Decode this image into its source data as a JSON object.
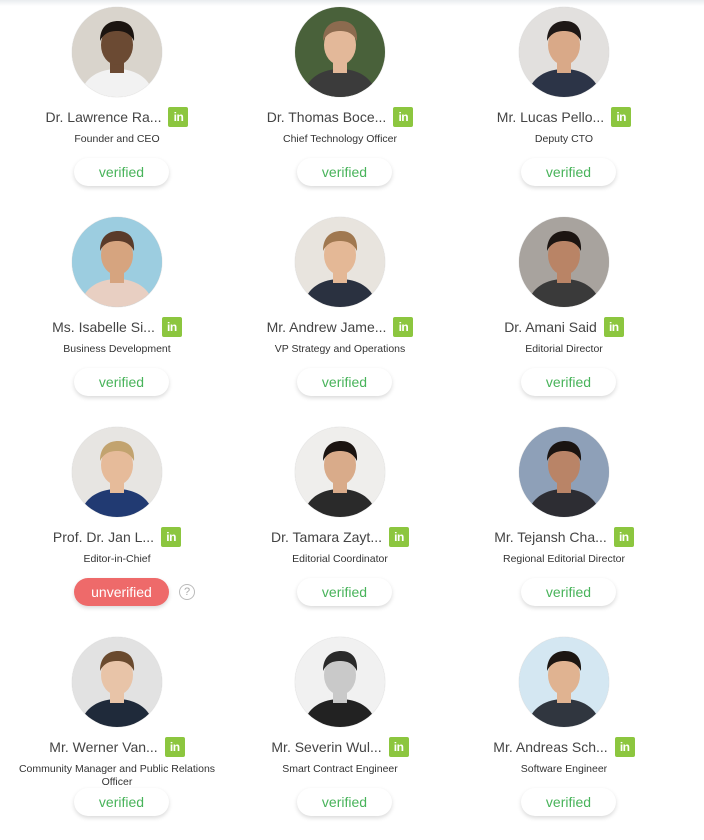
{
  "team": [
    {
      "name": "Dr. Lawrence Ra...",
      "role": "Founder and CEO",
      "status": "verified",
      "skin": "#6b4a33",
      "bg": "#d9d4cc",
      "hair": "#1b1410",
      "shirt": "#f2f2f2"
    },
    {
      "name": "Dr. Thomas Boce...",
      "role": "Chief Technology Officer",
      "status": "verified",
      "skin": "#e3b899",
      "bg": "#49613a",
      "hair": "#8c6b4f",
      "shirt": "#3b3b3b"
    },
    {
      "name": "Mr. Lucas Pello...",
      "role": "Deputy CTO",
      "status": "verified",
      "skin": "#d9a988",
      "bg": "#e2e0de",
      "hair": "#1e1816",
      "shirt": "#2c3447"
    },
    {
      "name": "Ms. Isabelle Si...",
      "role": "Business Development",
      "status": "verified",
      "skin": "#d6a47f",
      "bg": "#9ccde0",
      "hair": "#5a3b2a",
      "shirt": "#e8cfc2"
    },
    {
      "name": "Mr. Andrew Jame...",
      "role": "VP Strategy and Operations",
      "status": "verified",
      "skin": "#e4b896",
      "bg": "#e8e4de",
      "hair": "#a07850",
      "shirt": "#2a3140"
    },
    {
      "name": "Dr. Amani Said",
      "role": "Editorial Director",
      "status": "verified",
      "skin": "#b98466",
      "bg": "#a8a39e",
      "hair": "#1c1512",
      "shirt": "#3a3a3a"
    },
    {
      "name": "Prof. Dr. Jan L...",
      "role": "Editor-in-Chief",
      "status": "unverified",
      "skin": "#e6bb9a",
      "bg": "#e7e5e2",
      "hair": "#c2a36f",
      "shirt": "#213a72"
    },
    {
      "name": "Dr. Tamara Zayt...",
      "role": "Editorial Coordinator",
      "status": "verified",
      "skin": "#d9ab8a",
      "bg": "#efeeec",
      "hair": "#1b1411",
      "shirt": "#2a2a2a"
    },
    {
      "name": "Mr. Tejansh Cha...",
      "role": "Regional Editorial Director",
      "status": "verified",
      "skin": "#b98467",
      "bg": "#8ea0b8",
      "hair": "#1a1411",
      "shirt": "#2d2d33"
    },
    {
      "name": "Mr. Werner Van...",
      "role": "Community Manager and Public Relations Officer",
      "status": "verified",
      "skin": "#e8c4a8",
      "bg": "#e2e2e2",
      "hair": "#6a4a2e",
      "shirt": "#1f2a3a"
    },
    {
      "name": "Mr. Severin Wul...",
      "role": "Smart Contract Engineer",
      "status": "verified",
      "skin": "#c9c9c9",
      "bg": "#f1f1f1",
      "hair": "#2a2a2a",
      "shirt": "#222222"
    },
    {
      "name": "Mr. Andreas Sch...",
      "role": "Software Engineer",
      "status": "verified",
      "skin": "#e0b391",
      "bg": "#d4e7f2",
      "hair": "#1c1612",
      "shirt": "#30363f"
    }
  ],
  "linkedin_label": "in",
  "help_label": "?",
  "status_labels": {
    "verified": "verified",
    "unverified": "unverified"
  },
  "colors": {
    "verified_text": "#48b35a",
    "unverified_bg": "#ee6a6a",
    "linkedin": "#8cc63f"
  }
}
